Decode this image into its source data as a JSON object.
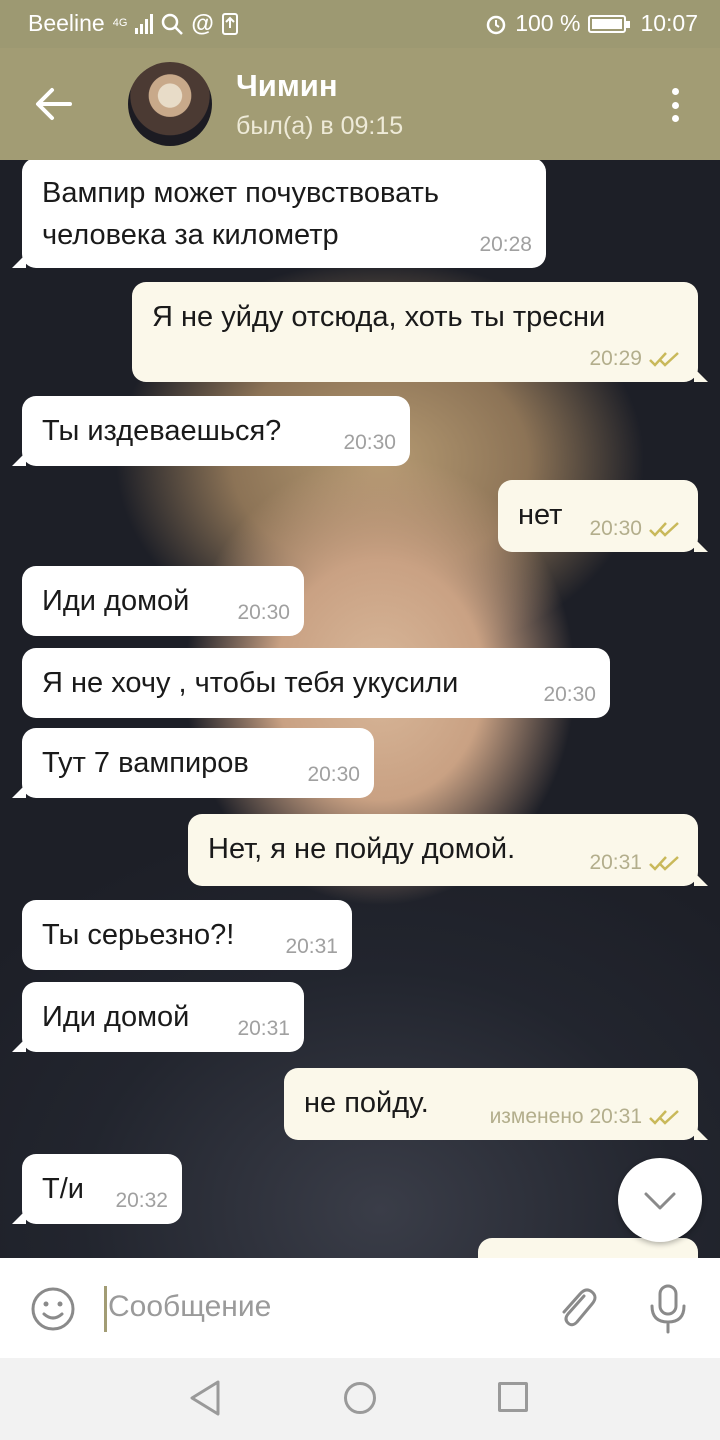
{
  "status_bar": {
    "carrier": "Beeline",
    "network": "4G",
    "battery_percent": "100 %",
    "time": "10:07"
  },
  "header": {
    "contact_name": "Чимин",
    "last_seen": "был(а) в 09:15",
    "accent_color": "#a29c74"
  },
  "messages": [
    {
      "direction": "in",
      "lines": [
        "Вампир может почувствовать",
        "человека за километр"
      ],
      "time": "20:28"
    },
    {
      "direction": "out",
      "lines": [
        "Я не уйду отсюда, хоть ты тресни"
      ],
      "time": "20:29",
      "status": "read"
    },
    {
      "direction": "in",
      "lines": [
        "Ты издеваешься?"
      ],
      "time": "20:30"
    },
    {
      "direction": "out",
      "lines": [
        "нет"
      ],
      "time": "20:30",
      "status": "read"
    },
    {
      "direction": "in",
      "lines": [
        "Иди домой"
      ],
      "time": "20:30"
    },
    {
      "direction": "in",
      "lines": [
        "Я не хочу , чтобы тебя укусили"
      ],
      "time": "20:30"
    },
    {
      "direction": "in",
      "lines": [
        "Тут 7 вампиров"
      ],
      "time": "20:30"
    },
    {
      "direction": "out",
      "lines": [
        "Нет, я не пойду домой."
      ],
      "time": "20:31",
      "status": "read"
    },
    {
      "direction": "in",
      "lines": [
        "Ты серьезно?!"
      ],
      "time": "20:31"
    },
    {
      "direction": "in",
      "lines": [
        "Иди домой"
      ],
      "time": "20:31"
    },
    {
      "direction": "out",
      "lines": [
        "не пойду."
      ],
      "time": "изменено 20:31",
      "status": "read"
    },
    {
      "direction": "in",
      "lines": [
        "Т/и"
      ],
      "time": "20:32"
    }
  ],
  "input": {
    "placeholder": "Сообщение"
  },
  "icons": [
    "back-arrow-icon",
    "more-vert-icon",
    "emoji-icon",
    "attach-icon",
    "mic-icon",
    "chevron-down-icon",
    "nav-back-icon",
    "nav-home-icon",
    "nav-recent-icon"
  ]
}
